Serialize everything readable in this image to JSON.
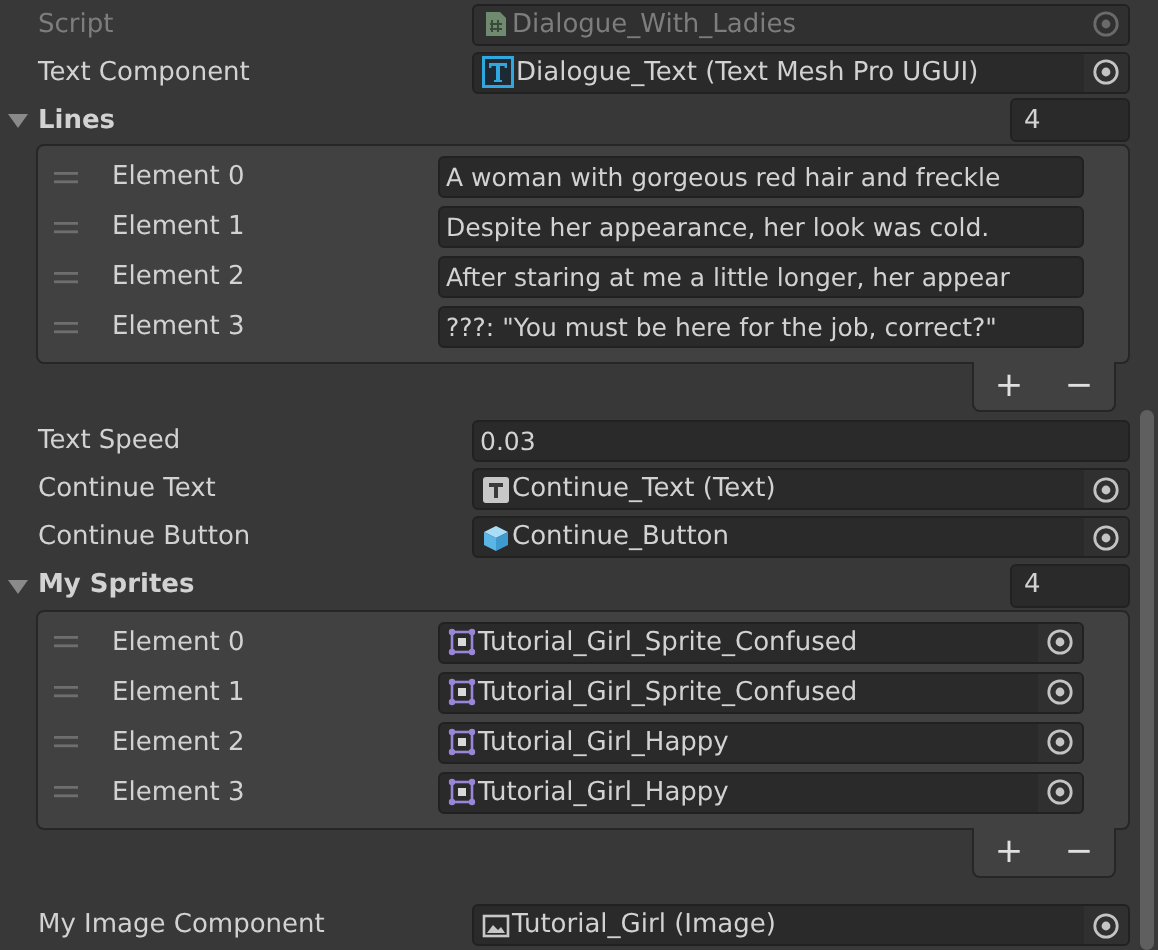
{
  "fields": [
    {
      "kind": "script",
      "label": "Script",
      "disabled": true,
      "value": "Dialogue_With_Ladies"
    },
    {
      "kind": "tmp_text",
      "label": "Text Component",
      "disabled": false,
      "value": "Dialogue_Text (Text Mesh Pro UGUI)"
    },
    {
      "kind": "list",
      "label": "Lines",
      "disabled": false,
      "expanded": true,
      "count": "4",
      "items": [
        {
          "label": "Element 0",
          "kind": "string",
          "value": "A woman with gorgeous red hair and freckle"
        },
        {
          "label": "Element 1",
          "kind": "string",
          "value": "Despite her appearance, her look was cold."
        },
        {
          "label": "Element 2",
          "kind": "string",
          "value": "After staring at me a little longer, her appear"
        },
        {
          "label": "Element 3",
          "kind": "string",
          "value": "???: \"You must be here for the job, correct?\""
        }
      ],
      "buttons": [
        "+",
        "−"
      ]
    },
    {
      "kind": "number",
      "label": "Text Speed",
      "disabled": false,
      "value": "0.03"
    },
    {
      "kind": "text",
      "label": "Continue Text",
      "disabled": false,
      "value": "Continue_Text (Text)"
    },
    {
      "kind": "prefab",
      "label": "Continue Button",
      "disabled": false,
      "value": "Continue_Button"
    },
    {
      "kind": "list",
      "label": "My Sprites",
      "disabled": false,
      "expanded": true,
      "count": "4",
      "items": [
        {
          "label": "Element 0",
          "kind": "sprite",
          "value": "Tutorial_Girl_Sprite_Confused"
        },
        {
          "label": "Element 1",
          "kind": "sprite",
          "value": "Tutorial_Girl_Sprite_Confused"
        },
        {
          "label": "Element 2",
          "kind": "sprite",
          "value": "Tutorial_Girl_Happy"
        },
        {
          "label": "Element 3",
          "kind": "sprite",
          "value": "Tutorial_Girl_Happy"
        }
      ],
      "buttons": [
        "+",
        "−"
      ]
    },
    {
      "kind": "image",
      "label": "My Image Component",
      "disabled": false,
      "value": "Tutorial_Girl (Image)"
    }
  ]
}
